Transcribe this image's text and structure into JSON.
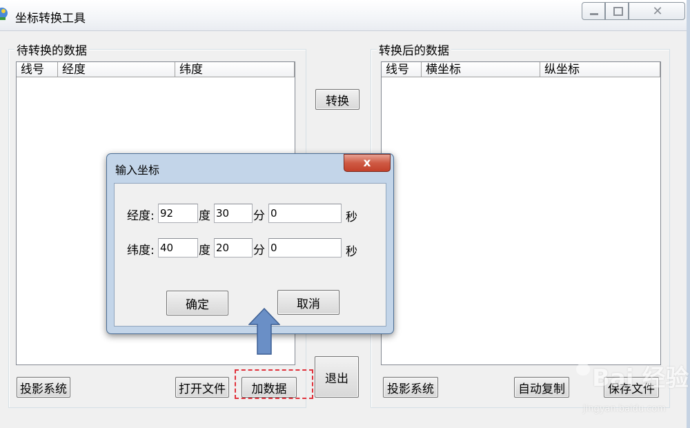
{
  "window": {
    "title": "坐标转换工具",
    "close_glyph": "✕"
  },
  "left_group": {
    "label": "待转换的数据",
    "columns": [
      "线号",
      "经度",
      "纬度"
    ],
    "projection_button": "投影系统",
    "open_file_button": "打开文件",
    "add_data_button": "加数据"
  },
  "middle": {
    "convert_button": "转换",
    "exit_button": "退出"
  },
  "right_group": {
    "label": "转换后的数据",
    "columns": [
      "线号",
      "横坐标",
      "纵坐标"
    ],
    "projection_button": "投影系统",
    "auto_button": "自动复制",
    "save_file_button": "保存文件"
  },
  "dialog": {
    "title": "输入坐标",
    "close_glyph": "x",
    "longitude": {
      "label": "经度:",
      "degree": "92",
      "minute": "30",
      "second": "0"
    },
    "latitude": {
      "label": "纬度:",
      "degree": "40",
      "minute": "20",
      "second": "0"
    },
    "unit_degree": "度",
    "unit_minute": "分",
    "unit_second": "秒",
    "ok_button": "确定",
    "cancel_button": "取消"
  },
  "watermark": {
    "text": "Bai 经验",
    "url": "jingyan.baidu.com"
  },
  "colors": {
    "highlight": "#e0303a",
    "arrow": "#6a8fc6",
    "dialog_close": "#c2402a"
  },
  "icons": [
    "app-icon",
    "minimize-icon",
    "maximize-icon",
    "close-icon",
    "up-arrow-icon",
    "paw-icon"
  ]
}
